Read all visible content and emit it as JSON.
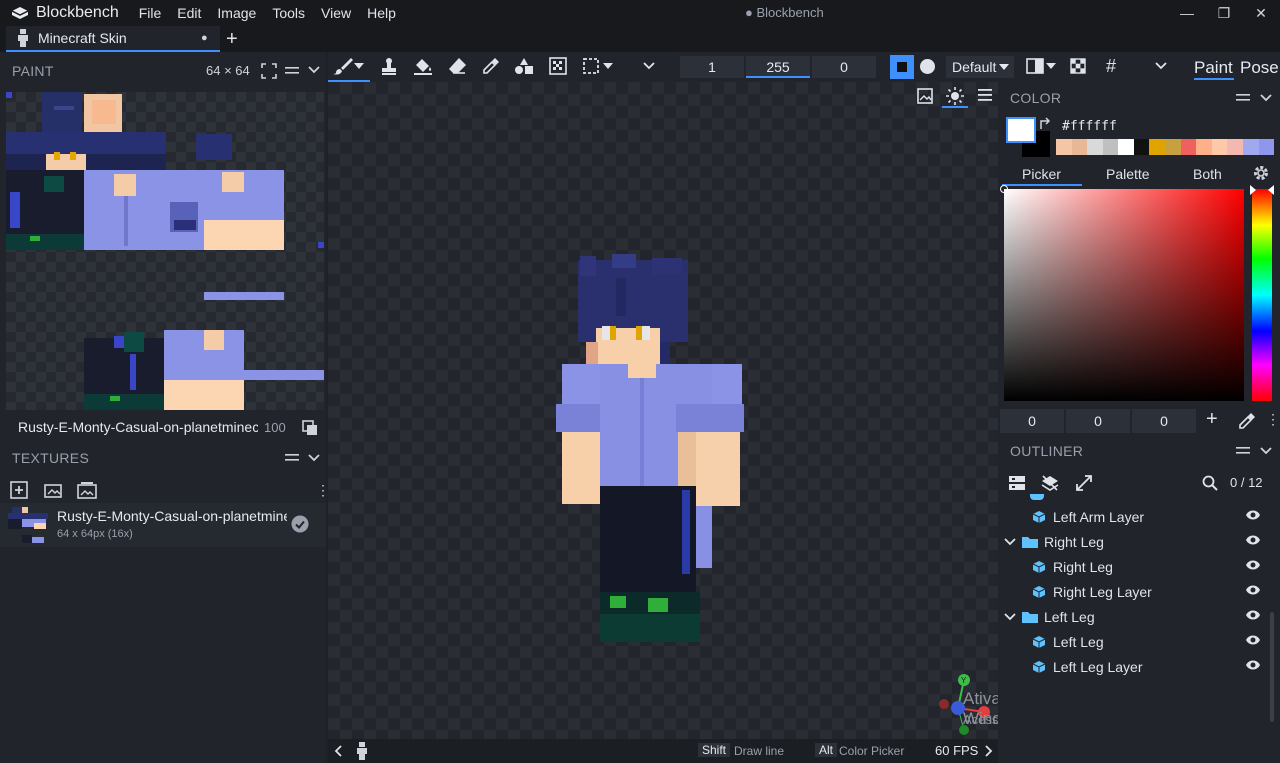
{
  "app": {
    "name": "Blockbench",
    "menu": [
      "File",
      "Edit",
      "Image",
      "Tools",
      "View",
      "Help"
    ],
    "window_title": "● Blockbench",
    "tab_label": "Minecraft Skin",
    "tab_dot": "●",
    "add_tab": "+"
  },
  "toolbar": {
    "brush_size": "1",
    "opacity": "255",
    "softness": "0",
    "blend_mode": "Default",
    "mode_paint": "Paint",
    "mode_pose": "Pose"
  },
  "paint_panel": {
    "title": "PAINT",
    "size": "64 × 64",
    "texture_name": "Rusty-E-Monty-Casual-on-planetminecra",
    "zoom": "100"
  },
  "textures_panel": {
    "title": "TEXTURES",
    "texture_name": "Rusty-E-Monty-Casual-on-planetminecı",
    "texture_info": "64 x 64px (16x)"
  },
  "color_panel": {
    "title": "COLOR",
    "hex": "#ffffff",
    "tabs": [
      "Picker",
      "Palette",
      "Both"
    ],
    "active_tab": "Picker",
    "rgb": [
      "0",
      "0",
      "0"
    ],
    "add": "+",
    "palette": [
      "#f5c6a5",
      "#e8b896",
      "#d9d9d9",
      "#bfbfbf",
      "#ffffff",
      "#111111",
      "#e0a400",
      "#c8a040",
      "#f06060",
      "#ffb08a",
      "#ffc8a8",
      "#f4b8b0",
      "#a0a8f0",
      "#8e96ee"
    ]
  },
  "outliner": {
    "title": "OUTLINER",
    "count": "0 / 12",
    "items": [
      {
        "label": "Left Arm Layer",
        "type": "cube",
        "depth": 1
      },
      {
        "label": "Right Leg",
        "type": "folder",
        "depth": 0
      },
      {
        "label": "Right Leg",
        "type": "cube",
        "depth": 1
      },
      {
        "label": "Right Leg Layer",
        "type": "cube",
        "depth": 1
      },
      {
        "label": "Left Leg",
        "type": "folder",
        "depth": 0
      },
      {
        "label": "Left Leg",
        "type": "cube",
        "depth": 1
      },
      {
        "label": "Left Leg Layer",
        "type": "cube",
        "depth": 1
      }
    ]
  },
  "status": {
    "key1": "Shift",
    "action1": "Draw line",
    "key2": "Alt",
    "action2": "Color Picker",
    "fps": "60 FPS"
  },
  "watermark": {
    "title": "Ativar o Windows",
    "subtitle": "Acesse Configurações para ativar o Windows."
  },
  "colors": {
    "accent": "#3e90ff",
    "hair": "#2a2f6e",
    "skin": "#f7cfa8",
    "shirt": "#8b93e6",
    "pants": "#141826",
    "shoes": "#0d2a2a"
  }
}
